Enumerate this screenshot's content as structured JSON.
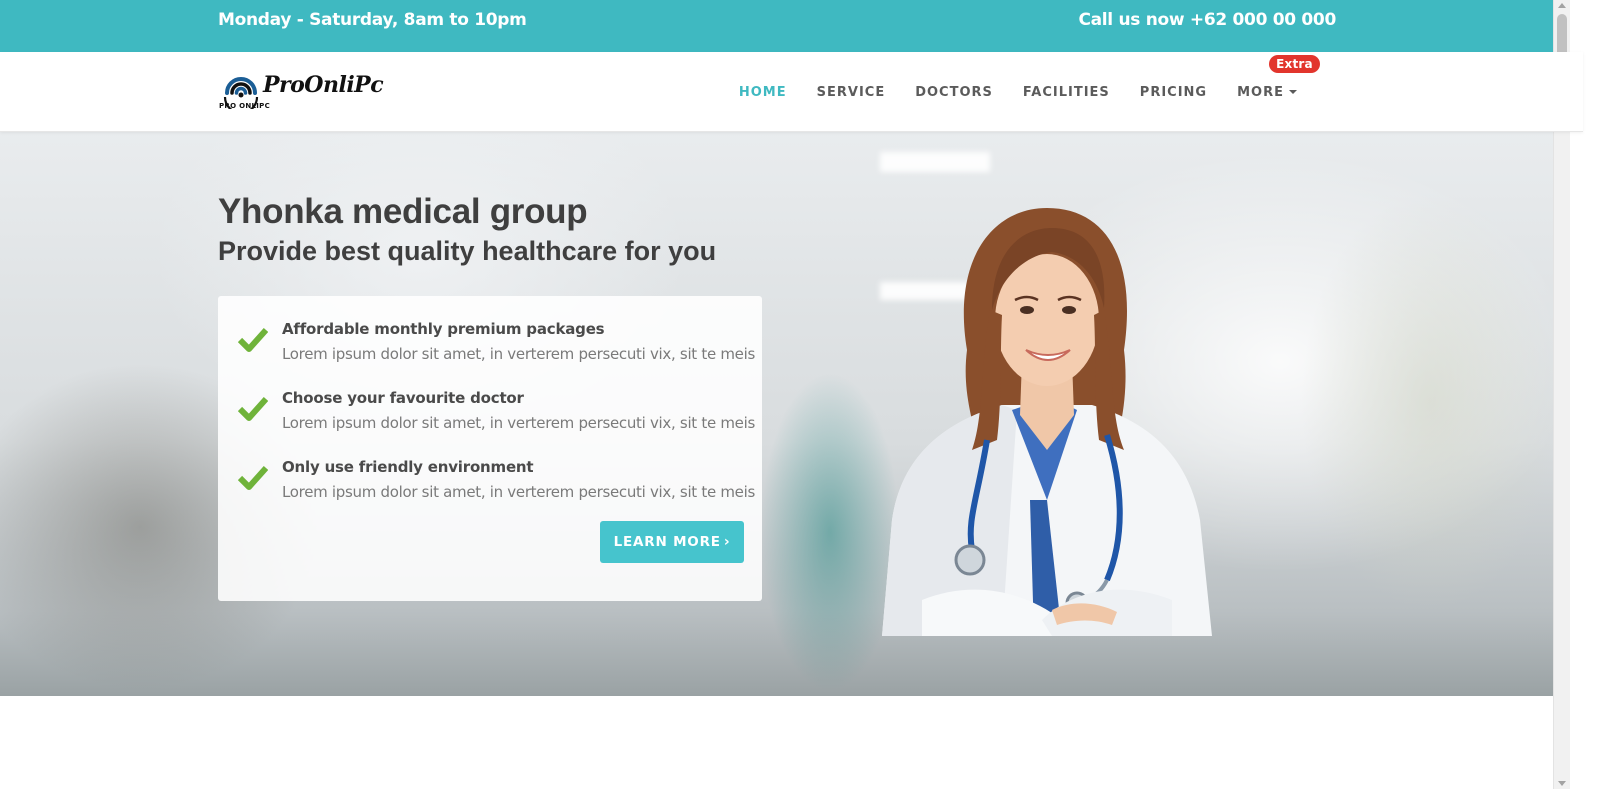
{
  "topbar": {
    "hours": "Monday - Saturday, 8am to 10pm",
    "phone": "Call us now +62 000 00 000",
    "bg_color": "#3fb9c1"
  },
  "logo": {
    "name": "ProOnliPc",
    "sub": "PRO ONLIPC"
  },
  "nav": {
    "items": [
      {
        "label": "HOME",
        "active": true
      },
      {
        "label": "SERVICE"
      },
      {
        "label": "DOCTORS"
      },
      {
        "label": "FACILITIES"
      },
      {
        "label": "PRICING"
      },
      {
        "label": "MORE"
      }
    ],
    "more_badge": "Extra",
    "accent_color": "#3fb9c1",
    "badge_color": "#e2352d"
  },
  "hero": {
    "title": "Yhonka medical group",
    "subtitle": "Provide best quality healthcare for you",
    "features": [
      {
        "title": "Affordable monthly premium packages",
        "desc": "Lorem ipsum dolor sit amet, in verterem persecuti vix, sit te meis"
      },
      {
        "title": "Choose your favourite doctor",
        "desc": "Lorem ipsum dolor sit amet, in verterem persecuti vix, sit te meis"
      },
      {
        "title": "Only use friendly environment",
        "desc": "Lorem ipsum dolor sit amet, in verterem persecuti vix, sit te meis"
      }
    ],
    "cta_label": "LEARN MORE",
    "cta_icon": "chevron-right-icon",
    "check_icon": "check-icon",
    "check_color": "#6fb33a"
  }
}
